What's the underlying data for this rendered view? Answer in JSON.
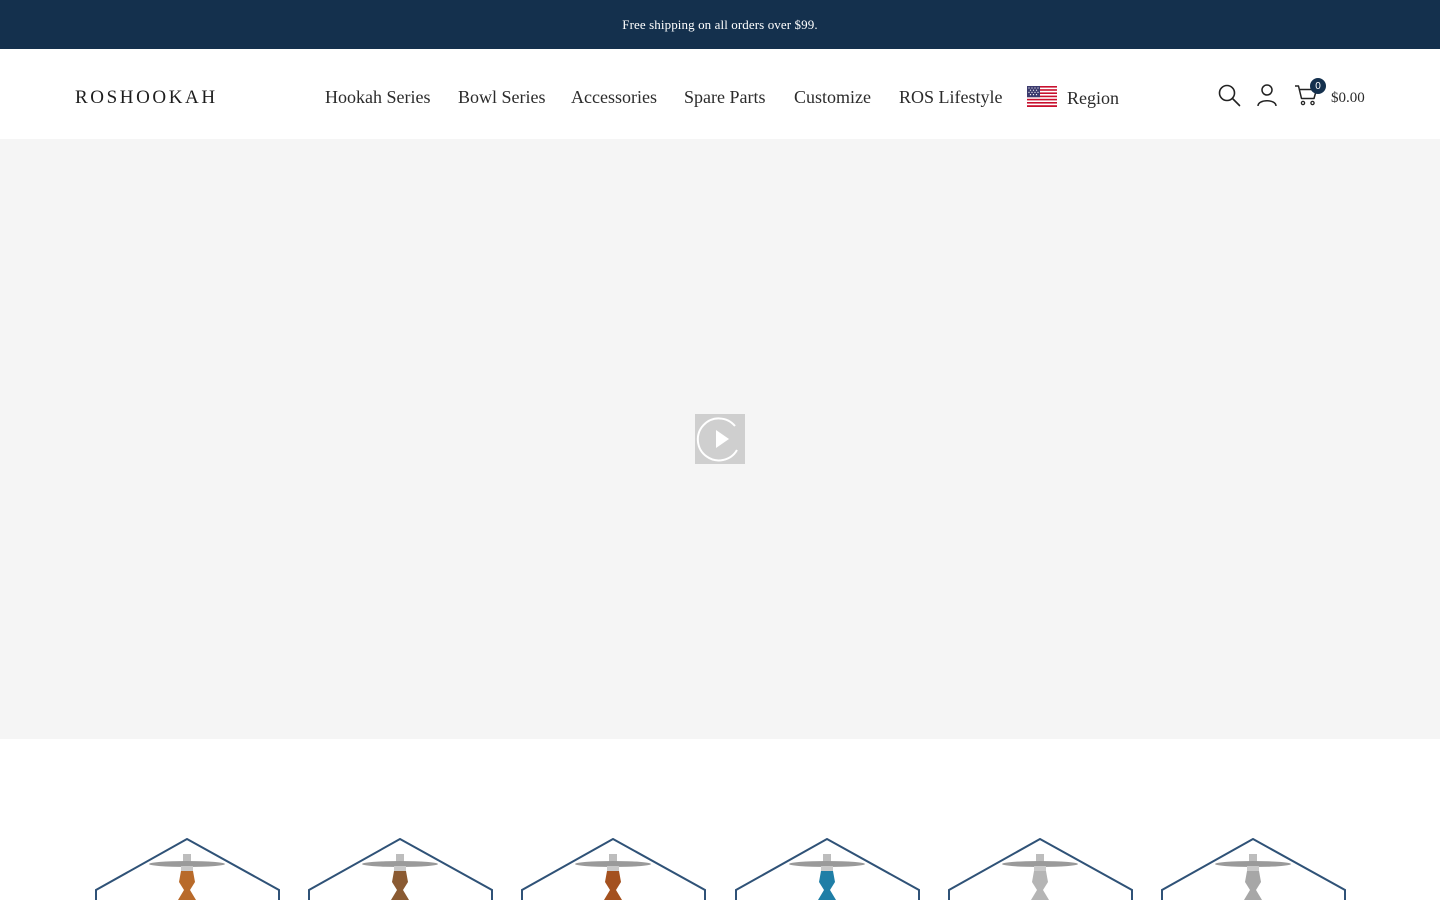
{
  "announcement": {
    "text": "Free shipping on all orders over $99."
  },
  "header": {
    "logo": "ROSHOOKAH",
    "nav": {
      "hookah_series": "Hookah Series",
      "bowl_series": "Bowl Series",
      "accessories": "Accessories",
      "spare_parts": "Spare Parts",
      "customize": "Customize",
      "ros_lifestyle": "ROS Lifestyle",
      "region": "Region"
    },
    "icons": [
      "us-flag-icon",
      "search-icon",
      "user-icon",
      "cart-icon"
    ],
    "cart": {
      "count": "0",
      "total": "$0.00"
    }
  },
  "hero": {
    "icon": "play-icon"
  },
  "products": {
    "items": [
      {
        "name": "hookah-product-1",
        "stem_color": "#b86a2a"
      },
      {
        "name": "hookah-product-2",
        "stem_color": "#8a5a32"
      },
      {
        "name": "hookah-product-3",
        "stem_color": "#a4511f"
      },
      {
        "name": "hookah-product-4",
        "stem_color": "#1f7ea6"
      },
      {
        "name": "hookah-product-5",
        "stem_color": "#b5b5b5"
      },
      {
        "name": "hookah-product-6",
        "stem_color": "#a7a7a7"
      }
    ]
  },
  "colors": {
    "brand_navy": "#14304d",
    "hero_bg": "#f5f5f5",
    "frame_blue": "#2f5277"
  }
}
